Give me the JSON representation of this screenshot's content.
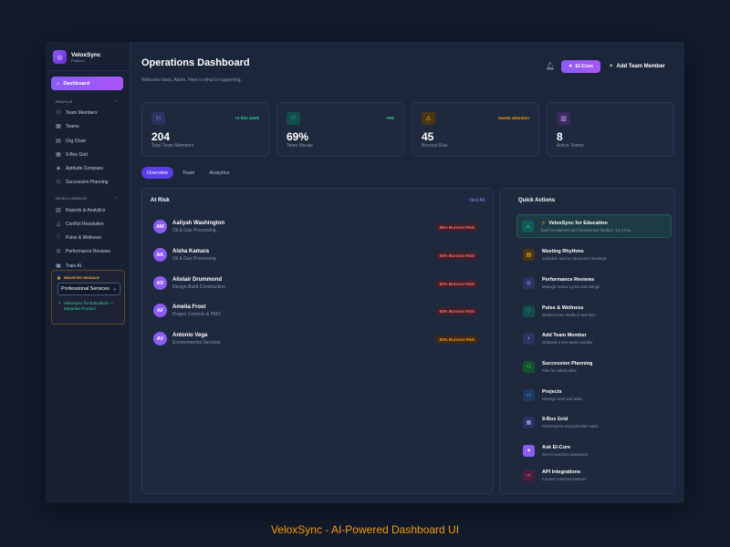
{
  "brand": {
    "name": "VeloxSync",
    "sub": "Platform"
  },
  "nav": {
    "dashboard": "Dashboard",
    "people_label": "PEOPLE",
    "people": [
      "Team Members",
      "Teams",
      "Org Chart",
      "9-Box Grid",
      "Aptitude Compass",
      "Succession Planning"
    ],
    "intel_label": "INTELLIGENCE",
    "intel": [
      "Reports & Analytics",
      "Conflict Resolution",
      "Pulse & Wellness",
      "Performance Reviews",
      "Train AI"
    ]
  },
  "industry": {
    "label": "INDUSTRY MODULE",
    "selected": "Professional Services",
    "link": "VeloxSync for Education — Separate Product"
  },
  "header": {
    "title": "Operations Dashboard",
    "subtitle": "Welcome back, Adam. Here is what is happening.",
    "ei_button": "EI-Core",
    "add_button": "Add Team Member"
  },
  "stats": [
    {
      "value": "204",
      "label": "Total Team Members",
      "delta": "+2 this week"
    },
    {
      "value": "69%",
      "label": "Team Morale",
      "delta": "+5%"
    },
    {
      "value": "45",
      "label": "Burnout Risk",
      "delta": "Needs attention"
    },
    {
      "value": "8",
      "label": "Active Teams",
      "delta": ""
    }
  ],
  "tabs": [
    "Overview",
    "Team",
    "Analytics"
  ],
  "at_risk": {
    "title": "At Risk",
    "view_all": "View All",
    "rows": [
      {
        "initials": "AW",
        "name": "Aaliyah Washington",
        "sub": "Oil & Gas Processing",
        "badge": "85% Burnout Risk"
      },
      {
        "initials": "AK",
        "name": "Aisha Kamara",
        "sub": "Oil & Gas Processing",
        "badge": "84% Burnout Risk"
      },
      {
        "initials": "AD",
        "name": "Alistair Drummond",
        "sub": "Design-Build Construction",
        "badge": "80% Burnout Risk"
      },
      {
        "initials": "AF",
        "name": "Amelia Frost",
        "sub": "Project Controls & PMO",
        "badge": "83% Burnout Risk"
      },
      {
        "initials": "AV",
        "name": "Antonio Vega",
        "sub": "Environmental Services",
        "badge": "82% Burnout Risk"
      }
    ]
  },
  "quick_actions": {
    "title": "Quick Actions",
    "items": [
      {
        "title": "🎓 VeloxSync for Education",
        "sub": "Built for teachers and homeschool families. Try it free.",
        "icon": "graduation-icon"
      },
      {
        "title": "Meeting Rhythms",
        "sub": "Schedule and run structured meetings",
        "icon": "calendar-icon"
      },
      {
        "title": "Performance Reviews",
        "sub": "Manage review cycles and ratings",
        "icon": "target-icon"
      },
      {
        "title": "Pulse & Wellness",
        "sub": "Monitor team health in real time",
        "icon": "heart-icon"
      },
      {
        "title": "Add Team Member",
        "sub": "Onboard a new team member",
        "icon": "plus-icon"
      },
      {
        "title": "Succession Planning",
        "sub": "Plan for critical roles",
        "icon": "users-icon"
      },
      {
        "title": "Projects",
        "sub": "Manage work and tasks",
        "icon": "folder-icon"
      },
      {
        "title": "9-Box Grid",
        "sub": "Performance and potential matrix",
        "icon": "grid-icon"
      },
      {
        "title": "Ask EI-Core",
        "sub": "Get AI coaching assistance",
        "icon": "bulb-icon"
      },
      {
        "title": "API Integrations",
        "sub": "Connect external systems",
        "icon": "link-icon"
      }
    ]
  },
  "footer": "VeloxSync - AI-Powered Dashboard UI",
  "colors": {
    "accent": "#8b5cf6",
    "danger": "#f87171",
    "warning": "#f59e0b",
    "success": "#34d399"
  }
}
